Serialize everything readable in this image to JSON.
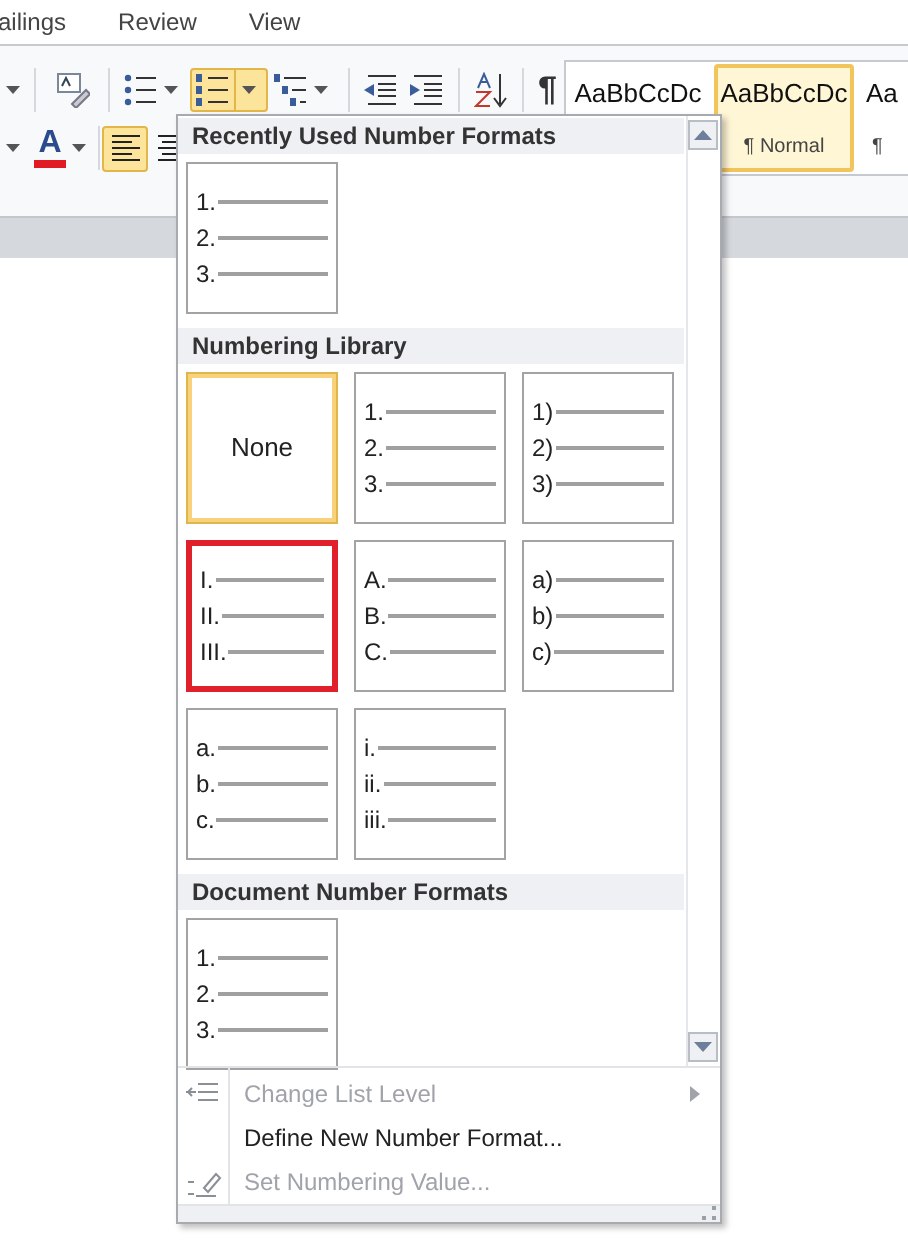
{
  "ribbon_tabs": [
    {
      "label": "ailings"
    },
    {
      "label": "Review"
    },
    {
      "label": "View"
    }
  ],
  "paragraph_buttons": [
    {
      "kind": "bullets",
      "selected": false
    },
    {
      "kind": "numbering",
      "selected": true
    },
    {
      "kind": "multilevel",
      "selected": false
    },
    {
      "kind": "decrease-indent",
      "selected": false
    },
    {
      "kind": "increase-indent",
      "selected": false
    },
    {
      "kind": "sort",
      "selected": false
    },
    {
      "kind": "pilcrow",
      "label": "¶",
      "selected": false
    }
  ],
  "format_buttons": [
    {
      "kind": "font-color",
      "label": "A",
      "selected": false
    },
    {
      "kind": "align-left",
      "selected": true
    },
    {
      "kind": "center",
      "selected": false
    }
  ],
  "styles": [
    {
      "sample": "AaBbCcDc",
      "selected": false
    },
    {
      "sample": "AaBbCcDc",
      "name": "¶ Normal",
      "selected": true
    },
    {
      "sample": "Aa",
      "name": "¶",
      "selected": false
    }
  ],
  "numbering_menu": {
    "sections": [
      {
        "title": "Recently Used Number Formats",
        "tiles": [
          {
            "kind": "list",
            "markers": [
              "1.",
              "2.",
              "3."
            ],
            "selected": false,
            "outlined": false
          }
        ]
      },
      {
        "title": "Numbering Library",
        "tiles": [
          {
            "kind": "none",
            "label": "None",
            "selected": true,
            "outlined": false
          },
          {
            "kind": "list",
            "markers": [
              "1.",
              "2.",
              "3."
            ],
            "selected": false,
            "outlined": false
          },
          {
            "kind": "list",
            "markers": [
              "1)",
              "2)",
              "3)"
            ],
            "selected": false,
            "outlined": false
          },
          {
            "kind": "list",
            "markers": [
              "I.",
              "II.",
              "III."
            ],
            "selected": false,
            "outlined": true
          },
          {
            "kind": "list",
            "markers": [
              "A.",
              "B.",
              "C."
            ],
            "selected": false,
            "outlined": false
          },
          {
            "kind": "list",
            "markers": [
              "a)",
              "b)",
              "c)"
            ],
            "selected": false,
            "outlined": false
          },
          {
            "kind": "list",
            "markers": [
              "a.",
              "b.",
              "c."
            ],
            "selected": false,
            "outlined": false
          },
          {
            "kind": "list",
            "markers": [
              "i.",
              "ii.",
              "iii."
            ],
            "selected": false,
            "outlined": false
          }
        ]
      },
      {
        "title": "Document Number Formats",
        "tiles": [
          {
            "kind": "list",
            "markers": [
              "1.",
              "2.",
              "3."
            ],
            "selected": false,
            "outlined": false
          }
        ]
      }
    ],
    "items": [
      {
        "kind": "level",
        "label": "Change List Level",
        "disabled": true,
        "submenu": true
      },
      {
        "kind": "define",
        "label": "Define New Number Format...",
        "disabled": false,
        "submenu": false
      },
      {
        "kind": "value",
        "label": "Set Numbering Value...",
        "disabled": true,
        "submenu": false
      }
    ]
  }
}
